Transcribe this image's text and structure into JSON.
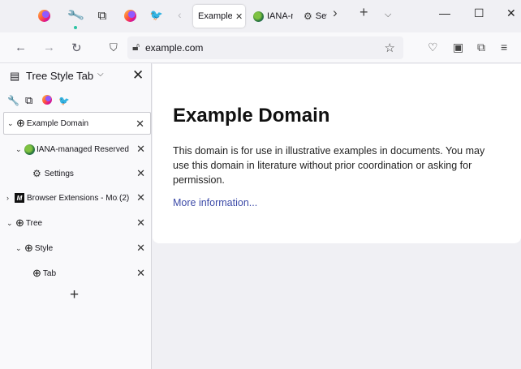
{
  "tabstrip": {
    "tabs": [
      {
        "label": "Example Domain",
        "close": "✕"
      },
      {
        "label": "IANA-managed Reserved Domains"
      },
      {
        "label": "Settings"
      }
    ],
    "icons": [
      "firefox-icon",
      "wrench-icon",
      "extensions-icon",
      "firefox-icon",
      "twitter-icon"
    ],
    "new_tab": "+",
    "list_all": "⌵",
    "scroll_right": "›",
    "scroll_left": "‹"
  },
  "window_controls": {
    "minimize": "—",
    "maximize": "☐",
    "close": "✕"
  },
  "navbar": {
    "back": "←",
    "forward": "→",
    "reload": "↻",
    "url": "example.com",
    "bookmark_star": "☆"
  },
  "sidebar": {
    "title": "Tree Style Tab",
    "caret": "⌵",
    "close": "✕",
    "tree": [
      {
        "label": "Example Domain",
        "twisty": "⌄",
        "active": true
      },
      {
        "label": "IANA-managed Reserved Domains",
        "twisty": "⌄"
      },
      {
        "label": "Settings"
      },
      {
        "label": "Browser Extensions - Mozilla",
        "count": "(2)",
        "twisty": "›"
      },
      {
        "label": "Tree",
        "twisty": "⌄"
      },
      {
        "label": "Style",
        "twisty": "⌄"
      },
      {
        "label": "Tab"
      }
    ],
    "new_tab": "+"
  },
  "page": {
    "heading": "Example Domain",
    "paragraph": "This domain is for use in illustrative examples in documents. You may use this domain in literature without prior coordination or asking for permission.",
    "link": "More information..."
  },
  "colors": {
    "link": "#3d4ba8",
    "chrome": "#f0f0f4",
    "content_card": "#ffffff"
  }
}
